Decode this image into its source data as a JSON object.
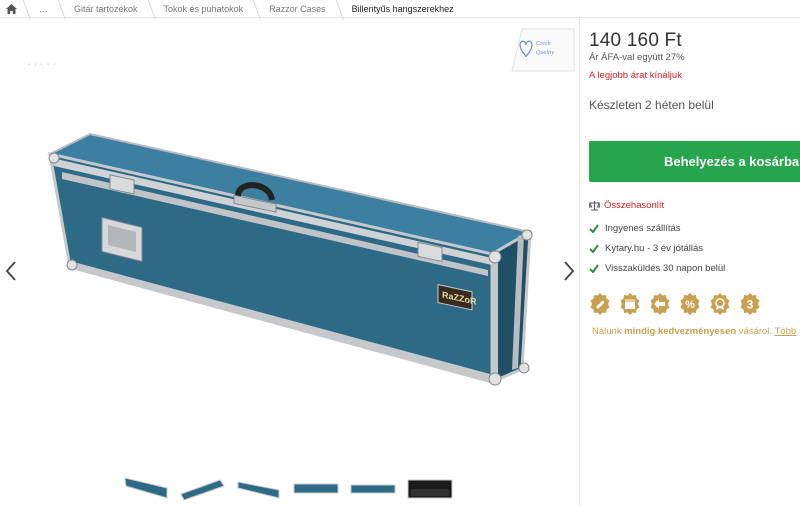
{
  "breadcrumb": {
    "items": [
      "…",
      "Gitár tartozékok",
      "Tokok és puhatokok",
      "Razzor Cases",
      "Billentyűs hangszerekhez"
    ]
  },
  "gallery": {
    "badge_line1": "Czech",
    "badge_line2": "Quality",
    "stray_text": "·  ·  ·  ·  ·",
    "brand_label": "RaZZoR",
    "thumbnail_count": 6,
    "selected_thumbnail": 1
  },
  "product": {
    "price": "140 160 Ft",
    "vat_note": "Ár ÁFA-val együtt 27%",
    "best_price": "A legjobb árat kínáljuk",
    "stock": "Készleten 2 héten belül",
    "cart_button": "Behelyezés a kosárba",
    "compare": "Összehasonlít",
    "benefits": [
      "Ingyenes szállítás",
      "Kytary.hu - 3 év jótállás",
      "Visszaküldés 30 napon belül"
    ],
    "badge_number": "3",
    "tagline_prefix": "Nálunk ",
    "tagline_bold": "mindig kedvezményesen",
    "tagline_suffix": " vásárol. ",
    "tagline_more": "Több"
  },
  "colors": {
    "accent_red": "#d0222a",
    "cart_green": "#27a54c",
    "check_green": "#2f8f46",
    "badge_gold": "#c8a050",
    "case_blue": "#2c6a86"
  }
}
